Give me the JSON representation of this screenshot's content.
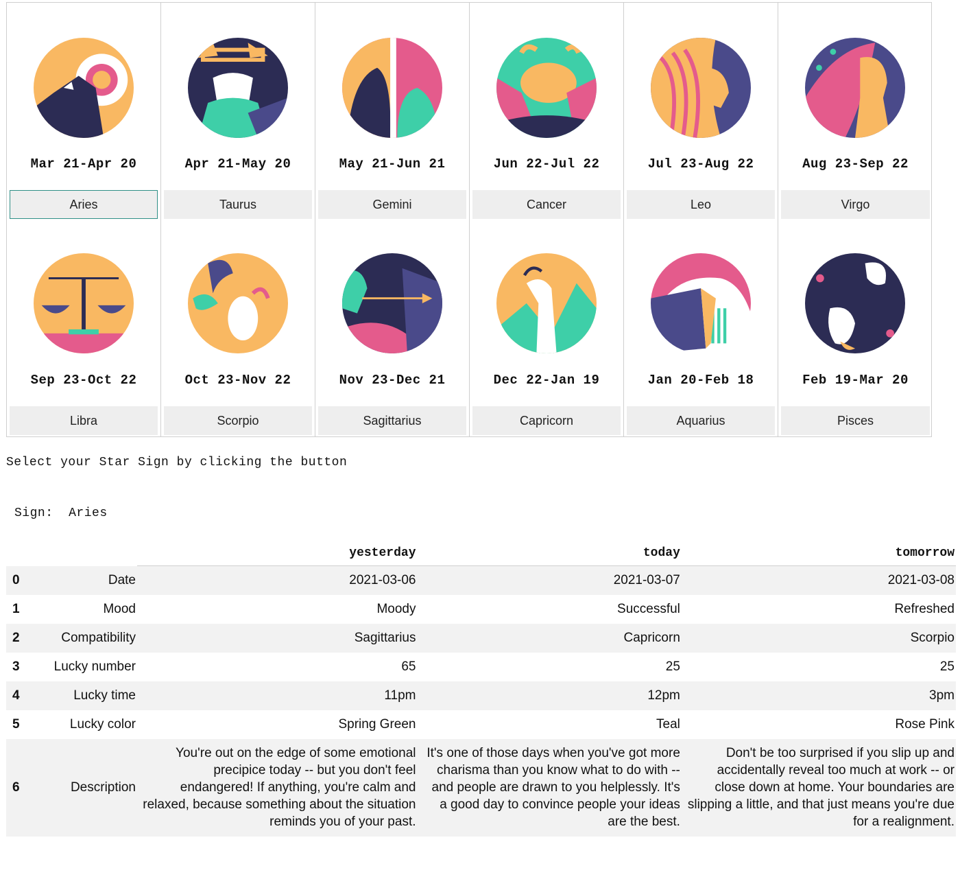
{
  "signs": [
    {
      "dates": "Mar 21-Apr 20",
      "name": "Aries",
      "icon": "aries-icon",
      "selected": true
    },
    {
      "dates": "Apr 21-May 20",
      "name": "Taurus",
      "icon": "taurus-icon"
    },
    {
      "dates": "May 21-Jun 21",
      "name": "Gemini",
      "icon": "gemini-icon"
    },
    {
      "dates": "Jun 22-Jul 22",
      "name": "Cancer",
      "icon": "cancer-icon"
    },
    {
      "dates": "Jul 23-Aug 22",
      "name": "Leo",
      "icon": "leo-icon"
    },
    {
      "dates": "Aug 23-Sep 22",
      "name": "Virgo",
      "icon": "virgo-icon"
    },
    {
      "dates": "Sep 23-Oct 22",
      "name": "Libra",
      "icon": "libra-icon"
    },
    {
      "dates": "Oct 23-Nov 22",
      "name": "Scorpio",
      "icon": "scorpio-icon"
    },
    {
      "dates": "Nov 23-Dec 21",
      "name": "Sagittarius",
      "icon": "sagittarius-icon"
    },
    {
      "dates": "Dec 22-Jan 19",
      "name": "Capricorn",
      "icon": "capricorn-icon"
    },
    {
      "dates": "Jan 20-Feb 18",
      "name": "Aquarius",
      "icon": "aquarius-icon"
    },
    {
      "dates": "Feb 19-Mar 20",
      "name": "Pisces",
      "icon": "pisces-icon"
    }
  ],
  "prompt": "Select your Star Sign by clicking the button",
  "selection": {
    "label": "Sign:",
    "value": "Aries"
  },
  "table": {
    "columns": [
      "yesterday",
      "today",
      "tomorrow"
    ],
    "rows": [
      {
        "index": "0",
        "label": "Date",
        "values": [
          "2021-03-06",
          "2021-03-07",
          "2021-03-08"
        ]
      },
      {
        "index": "1",
        "label": "Mood",
        "values": [
          "Moody",
          "Successful",
          "Refreshed"
        ]
      },
      {
        "index": "2",
        "label": "Compatibility",
        "values": [
          "Sagittarius",
          "Capricorn",
          "Scorpio"
        ]
      },
      {
        "index": "3",
        "label": "Lucky number",
        "values": [
          "65",
          "25",
          "25"
        ]
      },
      {
        "index": "4",
        "label": "Lucky time",
        "values": [
          "11pm",
          "12pm",
          "3pm"
        ]
      },
      {
        "index": "5",
        "label": "Lucky color",
        "values": [
          "Spring Green",
          "Teal",
          "Rose Pink"
        ]
      },
      {
        "index": "6",
        "label": "Description",
        "values": [
          "You're out on the edge of some emotional precipice today -- but you don't feel endangered! If anything, you're calm and relaxed, because something about the situation reminds you of your past.",
          "It's one of those days when you've got more charisma than you know what to do with -- and people are drawn to you helplessly. It's a good day to convince people your ideas are the best.",
          "Don't be too surprised if you slip up and accidentally reveal too much at work -- or close down at home. Your boundaries are slipping a little, and that just means you're due for a realignment."
        ]
      }
    ]
  },
  "colors": {
    "orange": "#f9b862",
    "navy": "#2c2c54",
    "teal": "#3ecfa8",
    "pink": "#e45b8c",
    "indigo": "#4a4a8a",
    "button_bg": "#eeeeee",
    "selected_border": "#2f8f86"
  }
}
